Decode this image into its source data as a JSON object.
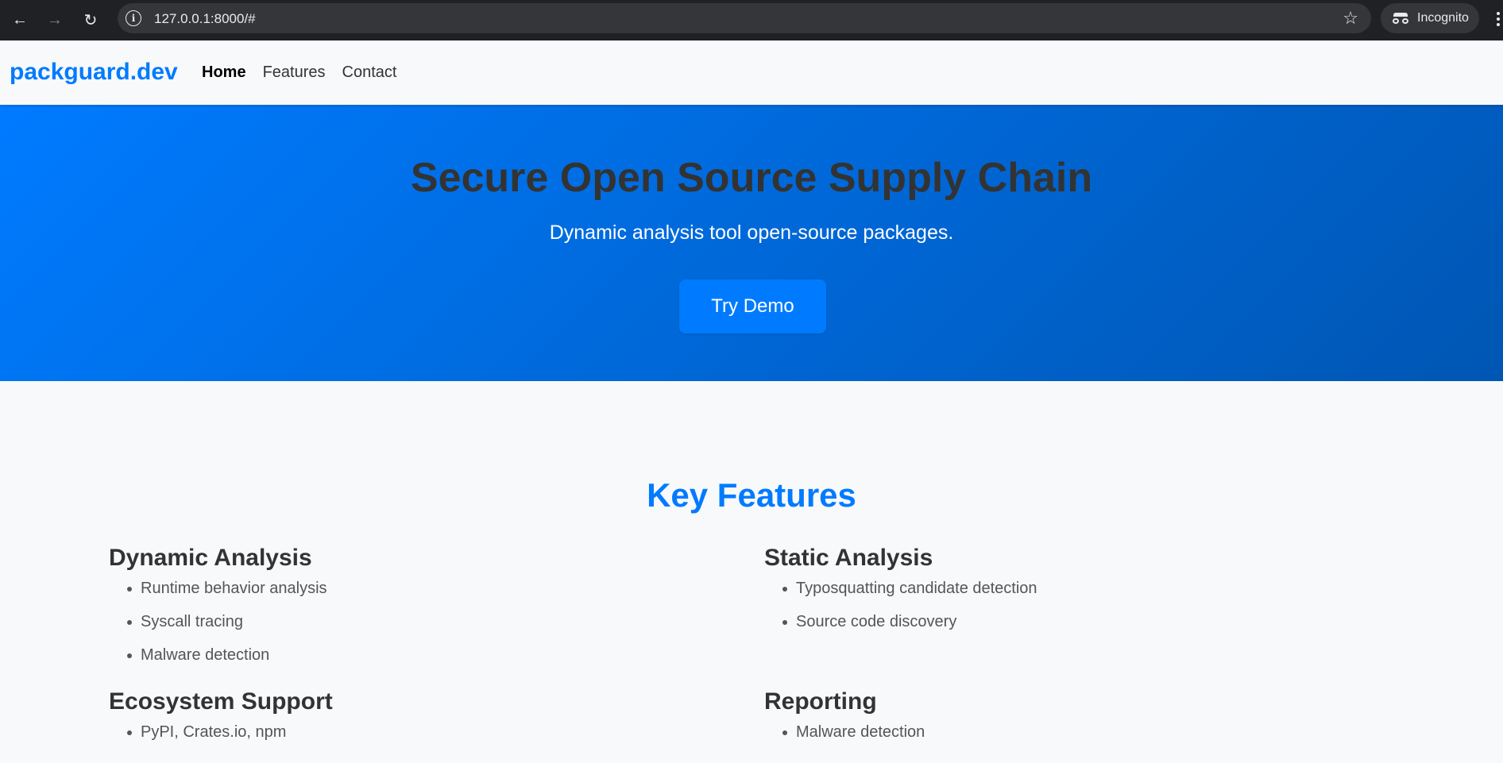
{
  "browser": {
    "url": "127.0.0.1:8000/#",
    "profile_label": "Incognito"
  },
  "site": {
    "logo": "packguard.dev",
    "nav": [
      {
        "label": "Home",
        "active": true
      },
      {
        "label": "Features",
        "active": false
      },
      {
        "label": "Contact",
        "active": false
      }
    ]
  },
  "hero": {
    "title": "Secure Open Source Supply Chain",
    "subtitle": "Dynamic analysis tool open-source packages.",
    "cta_label": "Try Demo"
  },
  "features": {
    "title": "Key Features",
    "sections": [
      {
        "title": "Dynamic Analysis",
        "items": [
          "Runtime behavior analysis",
          "Syscall tracing",
          "Malware detection"
        ]
      },
      {
        "title": "Static Analysis",
        "items": [
          "Typosquatting candidate detection",
          "Source code discovery"
        ]
      },
      {
        "title": "Ecosystem Support",
        "items": [
          "PyPI, Crates.io, npm"
        ]
      },
      {
        "title": "Reporting",
        "items": [
          "Malware detection"
        ]
      }
    ]
  },
  "colors": {
    "brand": "#007bff",
    "brand_dark": "#0056b3",
    "page_bg": "#f8f9fa",
    "text": "#333333"
  }
}
